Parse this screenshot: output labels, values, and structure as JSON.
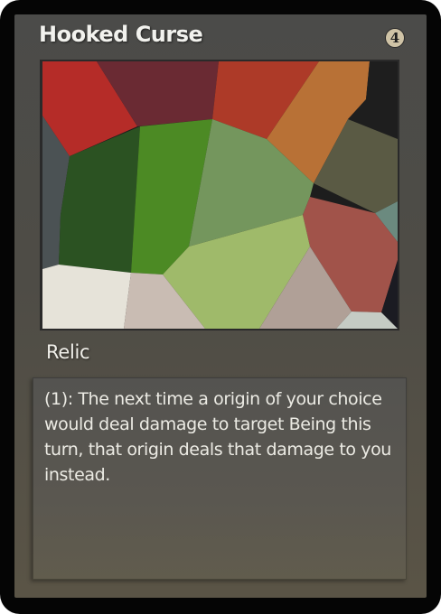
{
  "card": {
    "title": "Hooked Curse",
    "cost": "4",
    "type_line": "Relic",
    "rules_text": "(1): The next time a origin of your choice would deal damage to target Being this turn, that origin deals that damage to you instead."
  },
  "colors": {
    "outer_border": "#050505",
    "card_body": "#4e4c46",
    "title_text": "#f2f2ee",
    "cost_circle": "#cfc3a6",
    "text_box": "#58564f"
  },
  "art": {
    "style": "voronoi mosaic",
    "palette": [
      "#b52c28",
      "#6a2a33",
      "#ad3a28",
      "#b87136",
      "#2b5222",
      "#4c8a24",
      "#74965d",
      "#5a5a44",
      "#a1534a",
      "#9fba6a",
      "#b0a097",
      "#e6e3d9",
      "#c9bcb3",
      "#4b5254",
      "#1a1a1a",
      "#6b8a7f",
      "#c5cbc4"
    ]
  }
}
